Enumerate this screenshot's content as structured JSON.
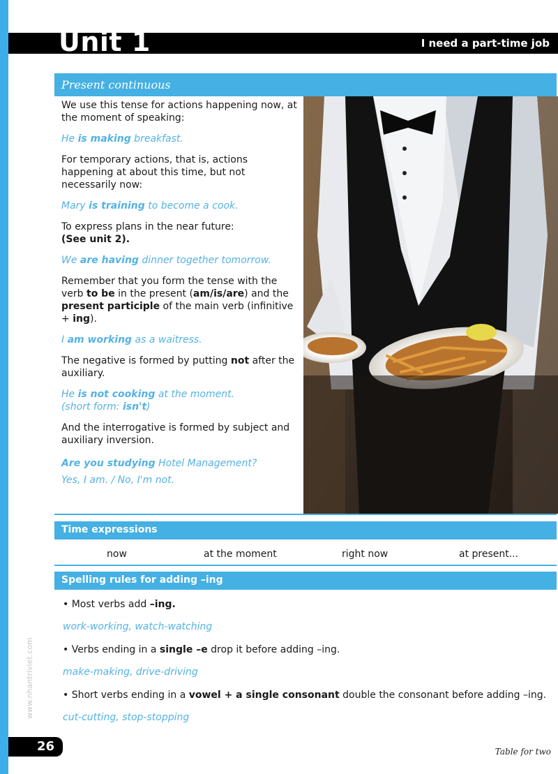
{
  "header": {
    "unit": "Unit 1",
    "subtitle": "I need a part-time job"
  },
  "present_continuous": {
    "title": "Present continuous",
    "p1": "We use this tense for actions happening now, at the moment of speaking:",
    "ex1_a": "He ",
    "ex1_b": "is making",
    "ex1_c": " breakfast.",
    "p2": "For temporary actions, that is, actions happening at about this time, but not necessarily now:",
    "ex2_a": "Mary ",
    "ex2_b": "is training",
    "ex2_c": " to become a cook.",
    "p3": "To express plans in the near future:",
    "p3_bold": "(See unit 2).",
    "ex3_a": "We ",
    "ex3_b": "are having",
    "ex3_c": " dinner together tomorrow.",
    "p4_a": "Remember that you form the tense with the verb ",
    "p4_b": "to be",
    "p4_c": " in the present (",
    "p4_d": "am/is/are",
    "p4_e": ") and the ",
    "p4_f": "present participle",
    "p4_g": " of the main verb (infinitive + ",
    "p4_h": "ing",
    "p4_i": ").",
    "ex4_a": "I ",
    "ex4_b": "am working",
    "ex4_c": " as a waitress.",
    "p5_a": "The negative is formed by putting ",
    "p5_b": "not",
    "p5_c": " after the auxiliary.",
    "ex5_a": "He ",
    "ex5_b": "is not cooking",
    "ex5_c": " at the moment.",
    "ex5_d": "(short form: ",
    "ex5_e": "isn't",
    "ex5_f": ")",
    "p6": "And the interrogative is formed by subject and auxiliary inversion.",
    "ex6_a": "Are you studying",
    "ex6_b": " Hotel Management?",
    "ex6_c": "Yes, I am.  /  No, I'm not."
  },
  "time_expressions": {
    "title": "Time expressions",
    "items": [
      "now",
      "at the moment",
      "right now",
      "at present..."
    ]
  },
  "spelling": {
    "title": "Spelling rules for adding –ing",
    "r1_a": "•  Most verbs add ",
    "r1_b": "–ing.",
    "r1_ex": "work-working, watch-watching",
    "r2_a": "•  Verbs ending in a ",
    "r2_b": "single –e",
    "r2_c": " drop it before adding –ing.",
    "r2_ex": "make-making, drive-driving",
    "r3_a": "•  Short verbs ending in a ",
    "r3_b": "vowel + a single consonant",
    "r3_c": " double the consonant before adding –ing.",
    "r3_ex": "cut-cutting, stop-stopping"
  },
  "watermark": "www.nhantriviet.com",
  "page_number": "26",
  "footer": "Table for two",
  "colors": {
    "accent": "#44b0e3",
    "example_text": "#54b2e3",
    "bar": "#000000"
  }
}
